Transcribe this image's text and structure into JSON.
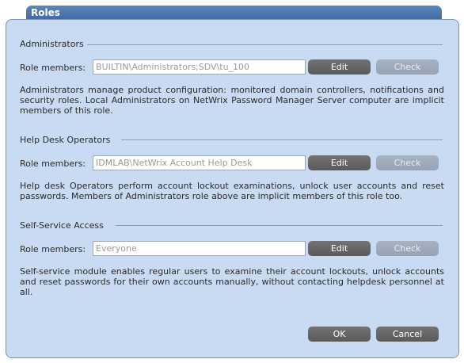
{
  "window": {
    "title": "Roles"
  },
  "sections": [
    {
      "title": "Administrators",
      "role_members_label": "Role members:",
      "members_value": "BUILTIN\\Administrators;SDV\\tu_100",
      "edit_label": "Edit",
      "check_label": "Check",
      "description": "Administrators manage product configuration: monitored domain controllers, notifications and security roles. Local Administrators on NetWrix Password Manager Server computer are implicit members of this role."
    },
    {
      "title": "Help Desk Operators",
      "role_members_label": "Role members:",
      "members_value": "IDMLAB\\NetWrix Account Help Desk",
      "edit_label": "Edit",
      "check_label": "Check",
      "description": "Help desk Operators perform account lockout examinations, unlock user accounts and reset passwords. Members of Administrators role above are implicit members of this role too."
    },
    {
      "title": "Self-Service Access",
      "role_members_label": "Role members:",
      "members_value": "Everyone",
      "edit_label": "Edit",
      "check_label": "Check",
      "description": "Self-service module enables regular users to examine their account lockouts, unlock accounts and reset passwords for their own accounts manually, without contacting helpdesk personnel at all."
    }
  ],
  "footer": {
    "ok_label": "OK",
    "cancel_label": "Cancel"
  },
  "colors": {
    "dialog_bg": "#c8dbf2",
    "title_bar": "#4a76b0",
    "button_active": "#666666",
    "button_disabled": "#a0acbd"
  }
}
